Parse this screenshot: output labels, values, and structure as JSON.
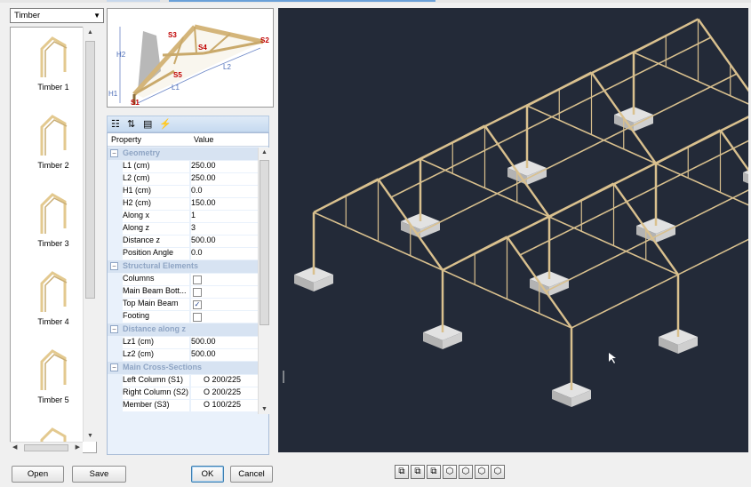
{
  "template_select": {
    "value": "Timber"
  },
  "thumbnails": [
    {
      "label": "Timber 1"
    },
    {
      "label": "Timber 2"
    },
    {
      "label": "Timber 3"
    },
    {
      "label": "Timber 4"
    },
    {
      "label": "Timber 5"
    }
  ],
  "diagram": {
    "labels": {
      "h1": "H1",
      "h2": "H2",
      "l1": "L1",
      "l2": "L2",
      "s1": "S1",
      "s2": "S2",
      "s3": "S3",
      "s4": "S4",
      "s5": "S5"
    }
  },
  "property_grid": {
    "header_property": "Property",
    "header_value": "Value",
    "categories": {
      "geometry": "Geometry",
      "structural": "Structural Elements",
      "distance": "Distance along z",
      "sections": "Main Cross-Sections"
    },
    "geometry": [
      {
        "name": "L1 (cm)",
        "value": "250.00"
      },
      {
        "name": "L2 (cm)",
        "value": "250.00"
      },
      {
        "name": "H1 (cm)",
        "value": "0.0"
      },
      {
        "name": "H2 (cm)",
        "value": "150.00"
      },
      {
        "name": "Along x",
        "value": "1"
      },
      {
        "name": "Along z",
        "value": "3"
      },
      {
        "name": "Distance z",
        "value": "500.00"
      },
      {
        "name": "Position Angle",
        "value": "0.0"
      }
    ],
    "structural": [
      {
        "name": "Columns",
        "checked": false
      },
      {
        "name": "Main Beam Bott...",
        "checked": false
      },
      {
        "name": "Top Main Beam",
        "checked": true
      },
      {
        "name": "Footing",
        "checked": false
      }
    ],
    "distance": [
      {
        "name": "Lz1 (cm)",
        "value": "500.00"
      },
      {
        "name": "Lz2 (cm)",
        "value": "500.00"
      }
    ],
    "sections": [
      {
        "name": "Left Column (S1)",
        "value": "O 200/225"
      },
      {
        "name": "Right Column (S2)",
        "value": "O 200/225"
      },
      {
        "name": "Member (S3)",
        "value": "O 100/225"
      }
    ]
  },
  "buttons": {
    "open": "Open",
    "save": "Save",
    "ok": "OK",
    "cancel": "Cancel"
  },
  "colors": {
    "viewport_bg": "#232a38",
    "timber": "#d9c08e",
    "footing": "#cfcfcf",
    "accent": "#c00000"
  },
  "view_buttons": [
    "view-iso-1-icon",
    "view-iso-2-icon",
    "view-iso-3-icon",
    "view-iso-4-icon",
    "view-iso-5-icon",
    "view-iso-6-icon",
    "view-iso-7-icon"
  ]
}
